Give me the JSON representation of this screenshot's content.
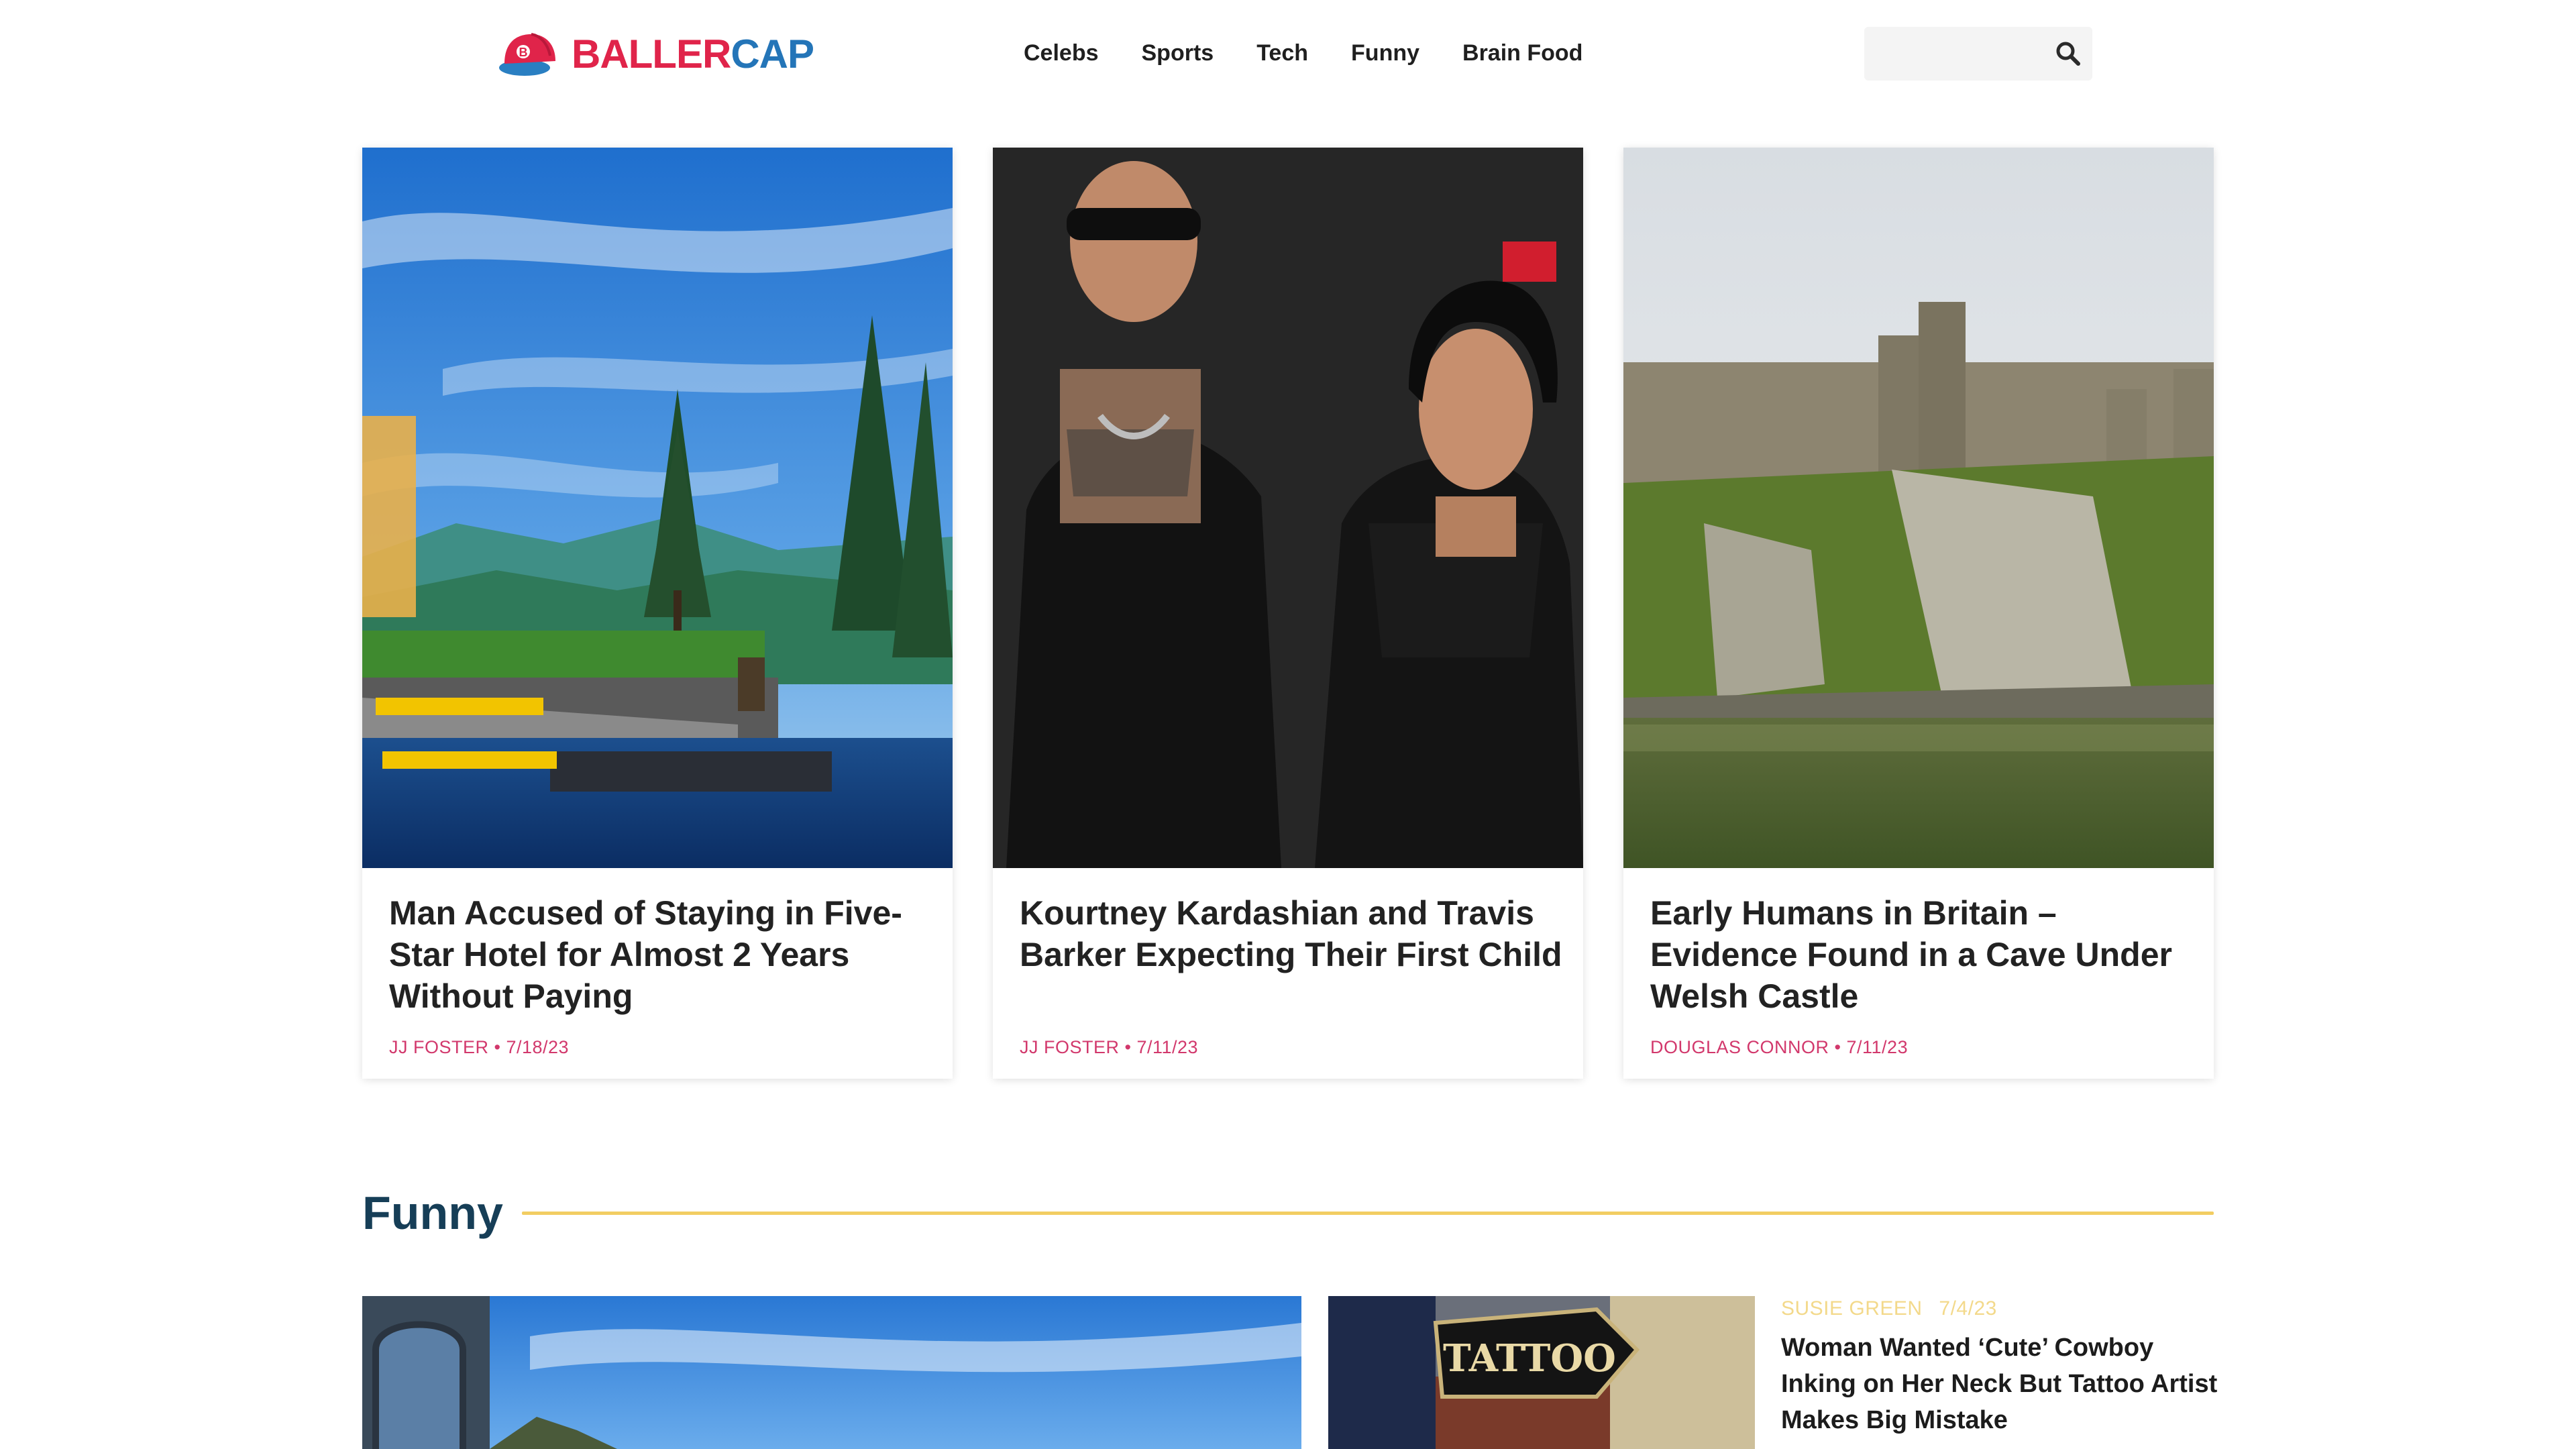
{
  "brand": {
    "part1": "BALLER",
    "part2": "CAP"
  },
  "nav": {
    "items": [
      "Celebs",
      "Sports",
      "Tech",
      "Funny",
      "Brain Food"
    ]
  },
  "search": {
    "placeholder": "",
    "value": ""
  },
  "cards": [
    {
      "title": "Man Accused of Staying in Five-Star Hotel for Almost 2 Years Without Paying",
      "author": "JJ FOSTER",
      "date": "7/18/23"
    },
    {
      "title": "Kourtney Kardashian and Travis Barker Expecting Their First Child",
      "author": "JJ FOSTER",
      "date": "7/11/23"
    },
    {
      "title": "Early Humans in Britain – Evidence Found in a Cave Under Welsh Castle",
      "author": "DOUGLAS CONNOR",
      "date": "7/11/23"
    }
  ],
  "section": {
    "title": "Funny"
  },
  "funny": {
    "small": {
      "author": "SUSIE GREEN",
      "date": "7/4/23",
      "title": "Woman Wanted ‘Cute’ Cowboy Inking on Her Neck But Tattoo Artist Makes Big Mistake",
      "tattoo_sign": "TATTOO"
    }
  },
  "colors": {
    "accent": "#e0244a",
    "brand_blue": "#2475b8",
    "meta": "#d2386c",
    "section": "#163e57",
    "rule": "#f2cd62"
  }
}
